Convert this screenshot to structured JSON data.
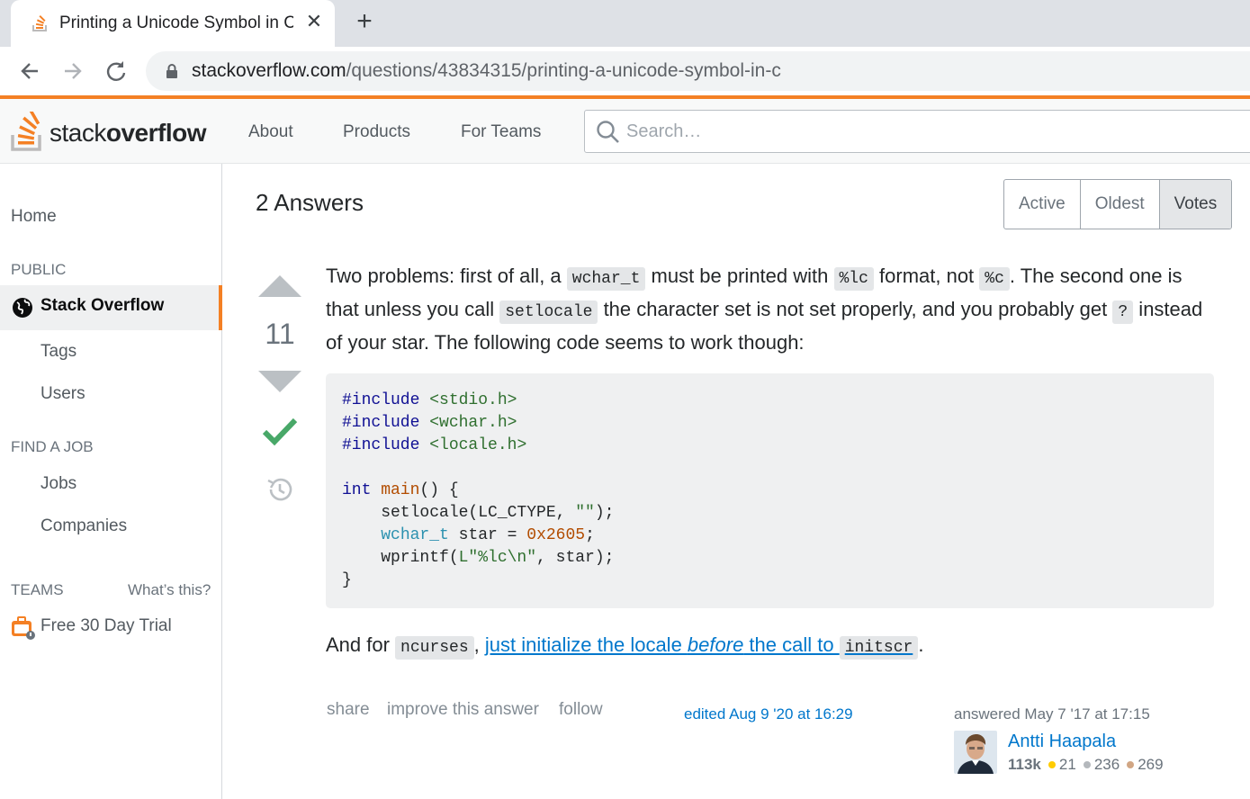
{
  "browser": {
    "tab_title": "Printing a Unicode Symbol in C",
    "tab_close": "✕",
    "new_tab": "+",
    "url_host": "stackoverflow.com",
    "url_path": "/questions/43834315/printing-a-unicode-symbol-in-c"
  },
  "header": {
    "logo_light": "stack",
    "logo_bold": "overflow",
    "nav": [
      "About",
      "Products",
      "For Teams"
    ],
    "search_placeholder": "Search…",
    "brand_color": "#f48024"
  },
  "sidebar": {
    "home": "Home",
    "public_heading": "PUBLIC",
    "active_item": "Stack Overflow",
    "tags": "Tags",
    "users": "Users",
    "find_job_heading": "FIND A JOB",
    "jobs": "Jobs",
    "companies": "Companies",
    "teams_heading": "TEAMS",
    "whats_this": "What’s this?",
    "free_trial": "Free 30 Day Trial"
  },
  "main": {
    "answers_title": "2 Answers",
    "sort_tabs": [
      "Active",
      "Oldest",
      "Votes"
    ],
    "sort_selected": "Votes",
    "vote_count": "11",
    "accepted": true,
    "body_p1": {
      "t1": "Two problems: first of all, a ",
      "c1": "wchar_t",
      "t2": " must be printed with ",
      "c2": "%lc",
      "t3": " format, not ",
      "c3": "%c",
      "t4": ". The second one is that unless you call ",
      "c4": "setlocale",
      "t5": " the character set is not set properly, and you probably get ",
      "c5": "?",
      "t6": " instead of your star. The following code seems to work though:"
    },
    "code": {
      "l1_kw": "#include",
      "l1_str": " <stdio.h>",
      "l2_kw": "#include",
      "l2_str": " <wchar.h>",
      "l3_kw": "#include",
      "l3_str": " <locale.h>",
      "l5_kw": "int",
      "l5_fn": " main",
      "l5_rest": "() {",
      "l6_a": "    setlocale(LC_CTYPE, ",
      "l6_str": "\"\"",
      "l6_b": ");",
      "l7_a": "    ",
      "l7_typ": "wchar_t",
      "l7_b": " star = ",
      "l7_num": "0x2605",
      "l7_c": ";",
      "l8_a": "    wprintf(",
      "l8_str": "L\"%lc\\n\"",
      "l8_b": ", star);",
      "l9": "}"
    },
    "body_p2": {
      "t1": "And for ",
      "c1": "ncurses",
      "t2": ", ",
      "link_a": "just initialize the locale ",
      "link_em": "before",
      "link_b": " the call to ",
      "c2": "initscr",
      "t3": "."
    },
    "post_menu": [
      "share",
      "improve this answer",
      "follow"
    ],
    "edited": "edited Aug 9 '20 at 16:29",
    "answered": "answered May 7 '17 at 17:15",
    "user": {
      "name": "Antti Haapala",
      "reputation": "113k",
      "gold": "21",
      "silver": "236",
      "bronze": "269"
    }
  }
}
